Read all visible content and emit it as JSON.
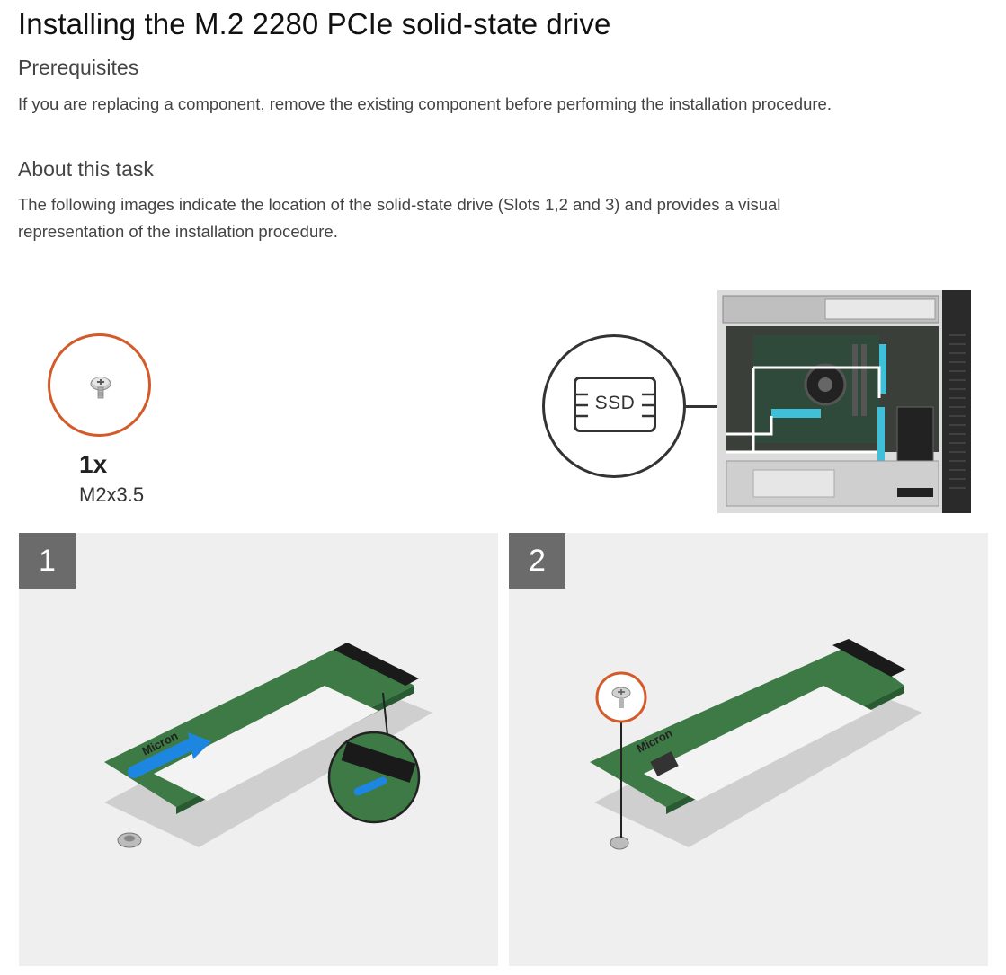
{
  "page": {
    "title": "Installing the M.2 2280 PCIe solid-state drive"
  },
  "prerequisites": {
    "heading": "Prerequisites",
    "text": "If you are replacing a component, remove the existing component before performing the installation procedure."
  },
  "about": {
    "heading": "About this task",
    "text_line1": "The following images indicate the location of the solid-state drive (Slots 1,2 and 3) and provides a visual",
    "text_line2": "representation of the installation procedure."
  },
  "screw": {
    "count": "1x",
    "label": "M2x3.5",
    "icon": "screw-icon",
    "ring_color": "#d45a2a"
  },
  "ssd_callout": {
    "label": "SSD",
    "icon": "ssd-icon",
    "highlight_color": "#3fc0d8"
  },
  "drive": {
    "brand": "Micron"
  },
  "steps": [
    {
      "number": "1"
    },
    {
      "number": "2"
    }
  ]
}
